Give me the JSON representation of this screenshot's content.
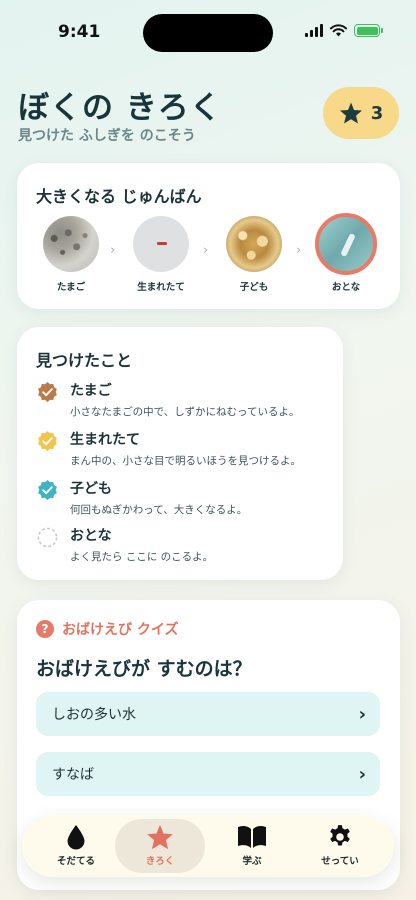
{
  "status_bar": {
    "time": "9:41",
    "battery_color": "#3ec15a",
    "icons": [
      "signal-icon",
      "wifi-icon",
      "battery-charging-icon"
    ]
  },
  "header": {
    "title": "ぼくの きろく",
    "subtitle": "見つけた ふしぎを のこそう",
    "star_count": "3",
    "star_icon": "star-icon"
  },
  "growth": {
    "title": "大きくなる じゅんばん",
    "stages": [
      {
        "label": "たまご",
        "active": false
      },
      {
        "label": "生まれたて",
        "active": false
      },
      {
        "label": "子ども",
        "active": false
      },
      {
        "label": "おとな",
        "active": true
      }
    ],
    "active_border_color": "#ea7a66"
  },
  "found": {
    "title": "見つけたこと",
    "items": [
      {
        "name": "たまご",
        "desc": "小さなたまごの中で、しずかにねむっているよ。",
        "checked": true,
        "color": "#b97b4b"
      },
      {
        "name": "生まれたて",
        "desc": "まん中の、小さな目で明るいほうを見つけるよ。",
        "checked": true,
        "color": "#f3c44b"
      },
      {
        "name": "子ども",
        "desc": "何回もぬぎかわって、大きくなるよ。",
        "checked": true,
        "color": "#3fb2c4"
      },
      {
        "name": "おとな",
        "desc": "よく見たら ここに のこるよ。",
        "checked": false,
        "color": "#c5c9c9"
      }
    ]
  },
  "quiz": {
    "title": "おばけえび クイズ",
    "question": "おばけえびが すむのは？",
    "options": [
      "しおの多い水",
      "すなば"
    ],
    "accent_color": "#e2725f",
    "option_bg": "#dff5f3"
  },
  "tabbar": {
    "tabs": [
      {
        "label": "そだてる",
        "icon": "drop-icon",
        "active": false
      },
      {
        "label": "きろく",
        "icon": "star-icon",
        "active": true
      },
      {
        "label": "学ぶ",
        "icon": "book-icon",
        "active": false
      },
      {
        "label": "せってい",
        "icon": "gear-icon",
        "active": false
      }
    ],
    "active_color": "#e2725f"
  }
}
